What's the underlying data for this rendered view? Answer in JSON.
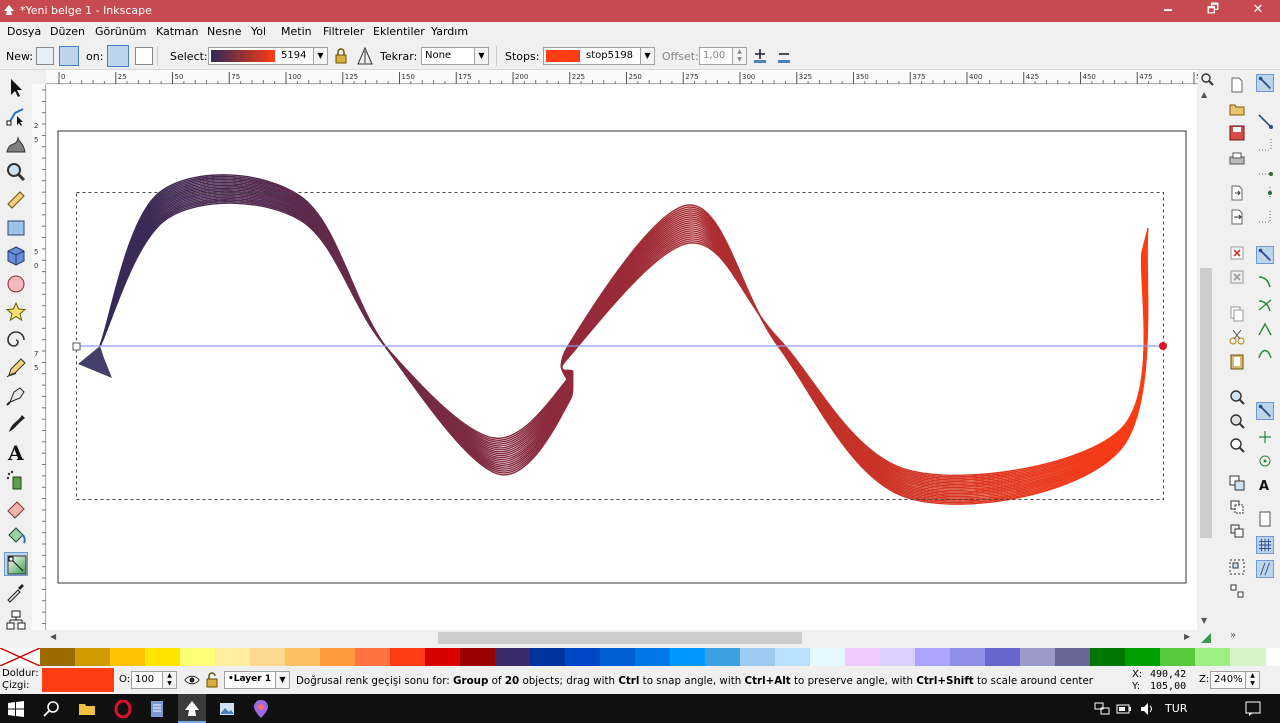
{
  "window": {
    "title": "*Yeni belge 1 - Inkscape",
    "minimize": "🗕",
    "maximize": "🗗",
    "close": "✕"
  },
  "menu": [
    "Dosya",
    "Düzen",
    "Görünüm",
    "Katman",
    "Nesne",
    "Yol",
    "Metin",
    "Filtreler",
    "Eklentiler",
    "Yardım"
  ],
  "toolctrl": {
    "new_label": "New:",
    "on_label": "on:",
    "select_label": "Select:",
    "gradient_id": "5194",
    "repeat_label": "Tekrar:",
    "repeat_value": "None",
    "stops_label": "Stops:",
    "stop_id": "stop5198",
    "offset_label": "Offset:",
    "offset_value": "1,00",
    "stop_color": "#ff3c12",
    "gradient_start": "#2f2a5a",
    "gradient_end": "#ff3c12"
  },
  "hruler": {
    "labels": [
      "0",
      "25",
      "50",
      "75",
      "100",
      "125",
      "150",
      "175",
      "200",
      "225",
      "250",
      "275",
      "300",
      "325",
      "350",
      "375",
      "400",
      "425",
      "450",
      "475",
      "500"
    ]
  },
  "vruler": {
    "labels": [
      "2",
      "5",
      "5",
      "0",
      "7",
      "5"
    ]
  },
  "status": {
    "fill_label": "Doldur:",
    "stroke_label": "Çizgi:",
    "fill_color": "#ff3c12",
    "opacity_label": "O:",
    "opacity_value": "100",
    "layer": "•Layer 1",
    "message_pre": "Doğrusal renk geçişi sonu for: ",
    "message_group": "Group",
    "message_of": " of ",
    "message_count": "20",
    "message_objects": " objects; drag with ",
    "message_ctrl": "Ctrl",
    "message_mid1": " to snap angle, with ",
    "message_ctrlalt": "Ctrl+Alt",
    "message_mid2": " to preserve angle, with ",
    "message_ctrlshift": "Ctrl+Shift",
    "message_end": " to scale around center",
    "x_label": "X:",
    "x_value": "490,42",
    "y_label": "Y:",
    "y_value": "105,00",
    "z_label": "Z:",
    "zoom": "240%"
  },
  "palette": [
    "#9b6b00",
    "#d19a00",
    "#ffc400",
    "#ffe500",
    "#ffff77",
    "#ffeea0",
    "#ffd890",
    "#ffc060",
    "#ff9b3d",
    "#ff7342",
    "#ff3c12",
    "#d80000",
    "#9a0000",
    "#3b2b6b",
    "#00339e",
    "#0047c7",
    "#005fd5",
    "#0077e6",
    "#0099ff",
    "#3aa0e0",
    "#9dcaf0",
    "#b9e0ff",
    "#e6f9ff",
    "#f2c9ff",
    "#d9d0ff",
    "#aba5ff",
    "#8f8fe8",
    "#6666cc",
    "#9999cc",
    "#666699",
    "#007700",
    "#00a000",
    "#55c93a",
    "#9ff084",
    "#d5f5c8"
  ],
  "taskbar": {
    "lang": "TUR"
  }
}
